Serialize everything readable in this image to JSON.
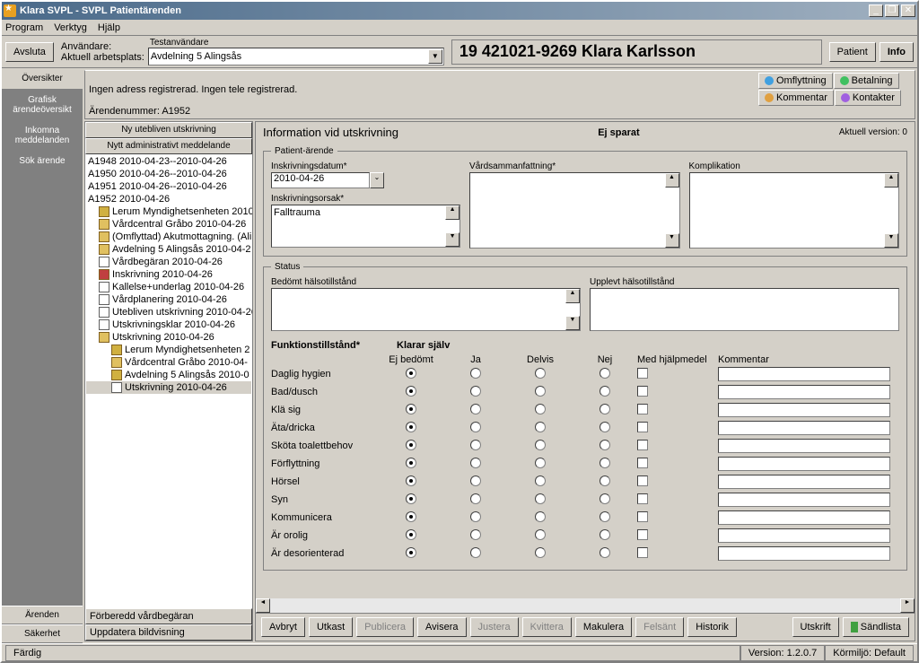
{
  "titlebar": "Klara SVPL - SVPL Patientärenden",
  "menubar": [
    "Program",
    "Verktyg",
    "Hjälp"
  ],
  "toolbar": {
    "avsluta": "Avsluta",
    "anvandare_label": "Användare:",
    "anvandare_value": "Testanvändare",
    "arbetsplats_label": "Aktuell arbetsplats:",
    "arbetsplats_value": "Avdelning 5 Alingsås",
    "patient_banner": "19 421021-9269 Klara Karlsson",
    "btn_patient": "Patient",
    "btn_info": "Info"
  },
  "sidebar": {
    "tabs": [
      "Översikter",
      "Grafisk ärendeöversikt",
      "Inkomna meddelanden",
      "Sök ärende"
    ],
    "bottom": [
      "Ärenden",
      "Säkerhet"
    ]
  },
  "infobar": {
    "line1": "Ingen adress registrerad.  Ingen tele registrerad.",
    "line2_label": "Ärendenummer:",
    "line2_value": "A1952",
    "actions": [
      {
        "label": "Omflyttning",
        "color": "#40a0e0"
      },
      {
        "label": "Betalning",
        "color": "#40c060"
      },
      {
        "label": "Kommentar",
        "color": "#e0a040"
      },
      {
        "label": "Kontakter",
        "color": "#a060e0"
      }
    ]
  },
  "left_panel": {
    "btn1": "Ny utebliven utskrivning",
    "btn2": "Nytt administrativt meddelande",
    "tree": [
      {
        "level": 0,
        "text": "A1948 2010-04-23--2010-04-26",
        "icon": null
      },
      {
        "level": 0,
        "text": "A1950 2010-04-26--2010-04-26",
        "icon": null
      },
      {
        "level": 0,
        "text": "A1951 2010-04-26--2010-04-26",
        "icon": null
      },
      {
        "level": 0,
        "text": "A1952 2010-04-26",
        "icon": null
      },
      {
        "level": 1,
        "text": "Lerum Myndighetsenheten 2010",
        "icon": "key"
      },
      {
        "level": 1,
        "text": "Vårdcentral Gråbo 2010-04-26",
        "icon": "folder"
      },
      {
        "level": 1,
        "text": "(Omflyttad) Akutmottagning. (Alin",
        "icon": "folder"
      },
      {
        "level": 1,
        "text": "Avdelning 5 Alingsås 2010-04-2",
        "icon": "folder"
      },
      {
        "level": 1,
        "text": "Vårdbegäran 2010-04-26",
        "icon": "doc"
      },
      {
        "level": 1,
        "text": "Inskrivning 2010-04-26",
        "icon": "red"
      },
      {
        "level": 1,
        "text": "Kallelse+underlag 2010-04-26",
        "icon": "doc"
      },
      {
        "level": 1,
        "text": "Vårdplanering 2010-04-26",
        "icon": "doc"
      },
      {
        "level": 1,
        "text": "Utebliven utskrivning 2010-04-26",
        "icon": "doc"
      },
      {
        "level": 1,
        "text": "Utskrivningsklar 2010-04-26",
        "icon": "doc"
      },
      {
        "level": 1,
        "text": "Utskrivning 2010-04-26",
        "icon": "folder"
      },
      {
        "level": 2,
        "text": "Lerum Myndighetsenheten 2",
        "icon": "key"
      },
      {
        "level": 2,
        "text": "Vårdcentral Gråbo 2010-04-",
        "icon": "folder"
      },
      {
        "level": 2,
        "text": "Avdelning 5 Alingsås 2010-0",
        "icon": "key"
      },
      {
        "level": 2,
        "text": "Utskrivning 2010-04-26",
        "icon": "doc",
        "selected": true
      }
    ],
    "bottom_btn1": "Förberedd vårdbegäran",
    "bottom_btn2": "Uppdatera bildvisning"
  },
  "form": {
    "title": "Information vid utskrivning",
    "status": "Ej sparat",
    "version": "Aktuell version: 0",
    "patient_group": "Patient-ärende",
    "inskrivningsdatum_label": "Inskrivningsdatum*",
    "inskrivningsdatum_value": "2010-04-26",
    "vardsammanfattning_label": "Vårdsammanfattning*",
    "komplikation_label": "Komplikation",
    "inskrivningsorsak_label": "Inskrivningsorsak*",
    "inskrivningsorsak_value": "Falltrauma",
    "status_group": "Status",
    "bedomt_label": "Bedömt hälsotillstånd",
    "upplevt_label": "Upplevt hälsotillstånd",
    "funk_header1": "Funktionstillstånd*",
    "funk_header2": "Klarar själv",
    "funk_cols": [
      "Ej bedömt",
      "Ja",
      "Delvis",
      "Nej"
    ],
    "funk_med": "Med hjälpmedel",
    "funk_kom": "Kommentar",
    "funk_rows": [
      "Daglig hygien",
      "Bad/dusch",
      "Klä sig",
      "Äta/dricka",
      "Sköta toalettbehov",
      "Förflyttning",
      "Hörsel",
      "Syn",
      "Kommunicera",
      "Är orolig",
      "Är desorienterad"
    ]
  },
  "button_bar": {
    "avbryt": "Avbryt",
    "utkast": "Utkast",
    "publicera": "Publicera",
    "avisera": "Avisera",
    "justera": "Justera",
    "kvittera": "Kvittera",
    "makulera": "Makulera",
    "felsant": "Felsänt",
    "historik": "Historik",
    "utskrift": "Utskrift",
    "sandlista": "Sändlista"
  },
  "statusbar": {
    "status": "Färdig",
    "version": "Version: 1.2.0.7",
    "env": "Körmiljö: Default"
  }
}
